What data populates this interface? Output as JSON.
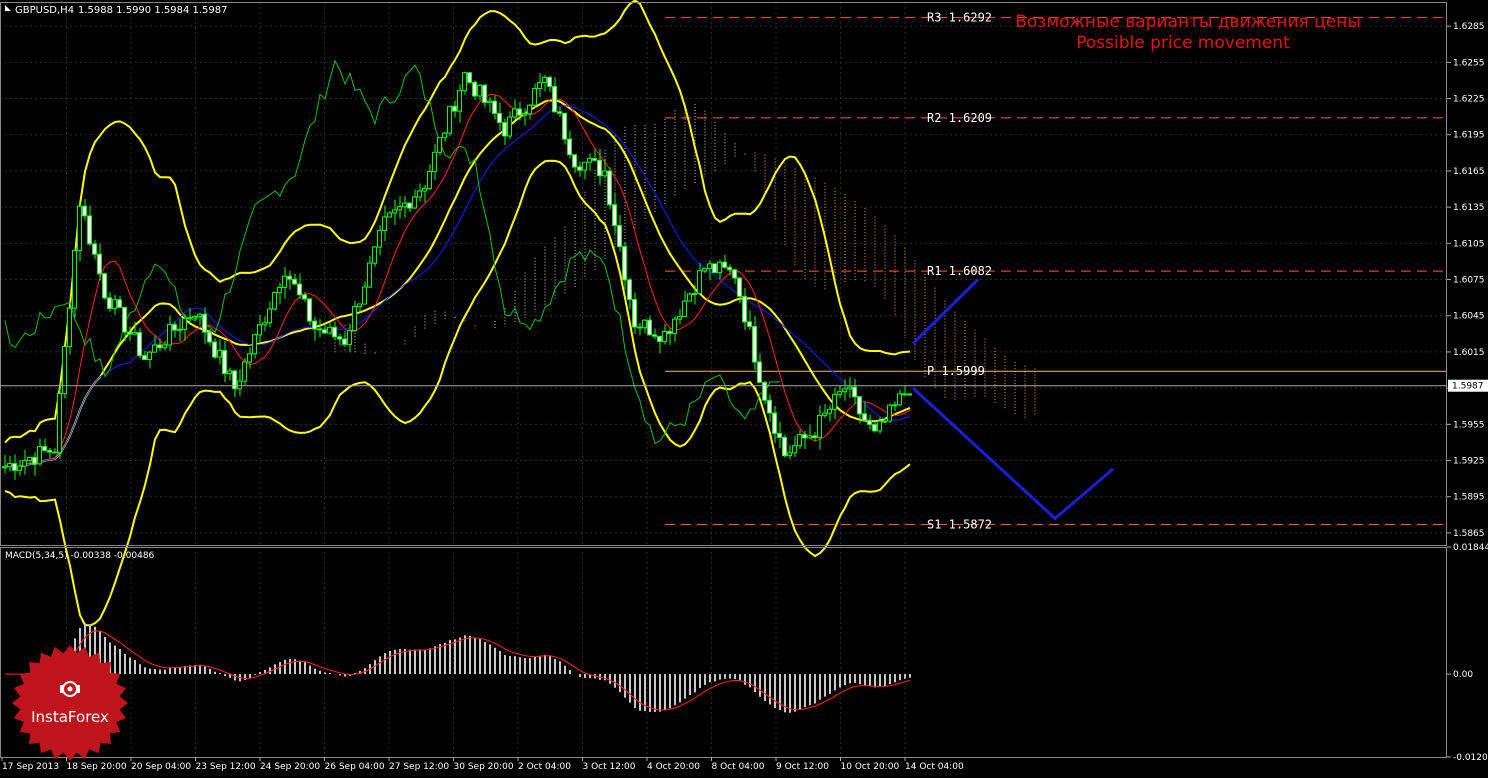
{
  "header": {
    "symbol": "GBPUSD,H4",
    "ohlc": "1.5988 1.5990 1.5984 1.5987"
  },
  "annotation": {
    "title_ru": "Возможные варианты движения цены",
    "title_en": "Possible price movement"
  },
  "logo": {
    "text": "InstaForex"
  },
  "colors": {
    "background": "#000000",
    "grid": "#2a2a2a",
    "axis_text": "#ffffff",
    "candle_body": "#00ff00",
    "bollinger": "#ffff00",
    "tenkan": "#ff2020",
    "kijun": "#1a1aff",
    "chikou": "#10c010",
    "cloud": "#ff9a50",
    "level_line": "#ff5a1f",
    "pivot_line": "#e8c060",
    "forecast": "#1a20d8",
    "macd_hist": "#c8c8c8",
    "macd_signal": "#ff2020",
    "annotation_text": "#e81010",
    "logo_bg": "#c0141c"
  },
  "chart_data": [
    {
      "id": "price",
      "type": "candlestick",
      "ylim": [
        1.5855,
        1.6305
      ],
      "y_ticks": [
        "1.6285",
        "1.6255",
        "1.6225",
        "1.6195",
        "1.6165",
        "1.6135",
        "1.6105",
        "1.6075",
        "1.6045",
        "1.6015",
        "1.5985",
        "1.5955",
        "1.5925",
        "1.5895",
        "1.5865"
      ],
      "current_price": "1.5987",
      "x_labels": [
        "17 Sep 2013",
        "18 Sep 20:00",
        "20 Sep 04:00",
        "23 Sep 12:00",
        "24 Sep 20:00",
        "26 Sep 04:00",
        "27 Sep 12:00",
        "30 Sep 20:00",
        "2 Oct 04:00",
        "3 Oct 12:00",
        "4 Oct 20:00",
        "8 Oct 04:00",
        "9 Oct 12:00",
        "10 Oct 20:00",
        "14 Oct 04:00"
      ],
      "levels": [
        {
          "name": "R3",
          "value": 1.6292,
          "label": "R3 1.6292"
        },
        {
          "name": "R2",
          "value": 1.6209,
          "label": "R2 1.6209"
        },
        {
          "name": "R1",
          "value": 1.6082,
          "label": "R1 1.6082"
        },
        {
          "name": "P",
          "value": 1.5999,
          "label": "P 1.5999"
        },
        {
          "name": "S1",
          "value": 1.5872,
          "label": "S1 1.5872"
        }
      ],
      "forecast_up": [
        1.6022,
        1.6075
      ],
      "forecast_down": [
        1.5985,
        1.5877,
        1.5918
      ]
    },
    {
      "id": "macd",
      "type": "bar",
      "title": "MACD(5,34,5) -0.00338 -0.00486",
      "ylim": [
        -0.01203,
        0.01844
      ],
      "y_ticks": [
        "0.01844",
        "0.00",
        "-0.01203"
      ]
    }
  ]
}
